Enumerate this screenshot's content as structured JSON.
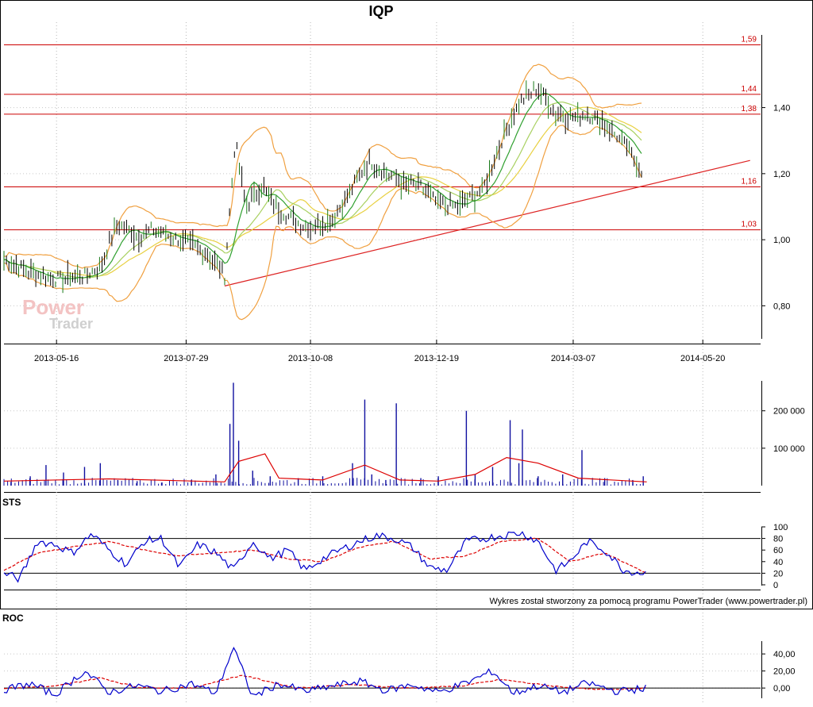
{
  "chart_data": [
    {
      "type": "candlestick",
      "title": "IQP",
      "x_tick_labels": [
        "2013-05-16",
        "2013-07-29",
        "2013-10-08",
        "2013-12-19",
        "2014-03-07",
        "2014-05-20"
      ],
      "x_range": [
        "2013-04-16",
        "2014-06-22"
      ],
      "y_tick_labels": [
        "1,40",
        "1,20",
        "1,00",
        "0,80"
      ],
      "ylim": [
        0.7,
        1.62
      ],
      "grid": true,
      "horizontal_levels": [
        {
          "value": 1.59,
          "label": "1,59"
        },
        {
          "value": 1.44,
          "label": "1,44"
        },
        {
          "value": 1.38,
          "label": "1,38"
        },
        {
          "value": 1.16,
          "label": "1,16"
        },
        {
          "value": 1.03,
          "label": "1,03"
        }
      ],
      "trend_line": {
        "start": {
          "date": "2013-08-20",
          "value": 0.86
        },
        "end": {
          "date": "2014-06-16",
          "value": 1.24
        }
      },
      "close_series": {
        "dates": [
          "2013-04-16",
          "2013-05-01",
          "2013-05-16",
          "2013-06-01",
          "2013-06-10",
          "2013-06-20",
          "2013-07-01",
          "2013-07-10",
          "2013-07-20",
          "2013-07-29",
          "2013-08-10",
          "2013-08-20",
          "2013-08-26",
          "2013-09-01",
          "2013-09-10",
          "2013-09-20",
          "2013-10-01",
          "2013-10-08",
          "2013-10-20",
          "2013-10-30",
          "2013-11-10",
          "2013-11-20",
          "2013-12-01",
          "2013-12-10",
          "2013-12-19",
          "2014-01-01",
          "2014-01-15",
          "2014-01-25",
          "2014-02-05",
          "2014-02-15",
          "2014-02-25",
          "2014-03-07",
          "2014-03-15",
          "2014-03-25",
          "2014-04-05",
          "2014-04-15"
        ],
        "values": [
          0.94,
          0.9,
          0.88,
          0.89,
          0.92,
          1.05,
          1.01,
          1.03,
          1.01,
          0.99,
          0.96,
          0.89,
          1.3,
          1.1,
          1.16,
          1.09,
          1.05,
          1.04,
          1.06,
          1.14,
          1.24,
          1.2,
          1.17,
          1.16,
          1.11,
          1.1,
          1.16,
          1.3,
          1.42,
          1.46,
          1.38,
          1.37,
          1.38,
          1.35,
          1.29,
          1.21
        ]
      }
    },
    {
      "type": "bar",
      "title": "",
      "y_tick_labels": [
        "200 000",
        "100 000"
      ],
      "ylim": [
        0,
        280000
      ],
      "bars": {
        "dates": [
          "2013-04-20",
          "2013-05-01",
          "2013-05-10",
          "2013-05-20",
          "2013-06-01",
          "2013-06-10",
          "2013-06-20",
          "2013-07-01",
          "2013-07-15",
          "2013-08-01",
          "2013-08-15",
          "2013-08-23",
          "2013-08-25",
          "2013-08-28",
          "2013-09-05",
          "2013-09-15",
          "2013-10-01",
          "2013-10-15",
          "2013-11-01",
          "2013-11-08",
          "2013-11-12",
          "2013-11-20",
          "2013-11-26",
          "2013-12-10",
          "2013-12-20",
          "2014-01-05",
          "2014-01-10",
          "2014-01-20",
          "2014-01-30",
          "2014-02-04",
          "2014-02-06",
          "2014-02-15",
          "2014-03-01",
          "2014-03-12",
          "2014-03-25",
          "2014-04-10",
          "2014-04-16"
        ],
        "values": [
          10000,
          25000,
          55000,
          35000,
          50000,
          60000,
          15000,
          12000,
          8000,
          15000,
          30000,
          165000,
          275000,
          120000,
          40000,
          25000,
          20000,
          25000,
          60000,
          230000,
          30000,
          15000,
          220000,
          20000,
          25000,
          200000,
          30000,
          50000,
          175000,
          60000,
          150000,
          25000,
          30000,
          95000,
          20000,
          15000,
          25000
        ]
      },
      "average_line": {
        "dates": [
          "2013-04-16",
          "2013-06-15",
          "2013-08-20",
          "2013-08-28",
          "2013-09-12",
          "2013-09-20",
          "2013-10-15",
          "2013-11-08",
          "2013-11-28",
          "2013-12-20",
          "2014-01-10",
          "2014-01-28",
          "2014-02-15",
          "2014-03-10",
          "2014-04-18"
        ],
        "values": [
          12000,
          18000,
          10000,
          65000,
          85000,
          20000,
          15000,
          55000,
          15000,
          12000,
          30000,
          75000,
          60000,
          20000,
          10000
        ]
      }
    },
    {
      "type": "line",
      "title": "STS",
      "y_tick_labels": [
        "100",
        "80",
        "60",
        "40",
        "20",
        "0"
      ],
      "ylim": [
        0,
        100
      ],
      "reference_levels": [
        80,
        20
      ],
      "series": [
        {
          "color": "#0000cc",
          "dates": [
            "2013-04-16",
            "2013-04-25",
            "2013-05-05",
            "2013-05-15",
            "2013-05-25",
            "2013-06-05",
            "2013-06-15",
            "2013-06-25",
            "2013-07-05",
            "2013-07-15",
            "2013-07-25",
            "2013-08-05",
            "2013-08-15",
            "2013-08-25",
            "2013-09-05",
            "2013-09-15",
            "2013-09-25",
            "2013-10-05",
            "2013-10-15",
            "2013-10-25",
            "2013-11-05",
            "2013-11-15",
            "2013-11-25",
            "2013-12-05",
            "2013-12-15",
            "2013-12-25",
            "2014-01-05",
            "2014-01-15",
            "2014-01-25",
            "2014-02-05",
            "2014-02-15",
            "2014-02-25",
            "2014-03-05",
            "2014-03-15",
            "2014-03-25",
            "2014-04-05",
            "2014-04-18"
          ],
          "values": [
            20,
            10,
            75,
            70,
            55,
            88,
            60,
            35,
            75,
            80,
            30,
            70,
            55,
            25,
            75,
            45,
            60,
            25,
            45,
            60,
            75,
            85,
            80,
            65,
            30,
            25,
            75,
            80,
            85,
            90,
            75,
            25,
            40,
            75,
            60,
            25,
            20
          ]
        },
        {
          "color": "#dd0000",
          "dates": [
            "2013-04-16",
            "2013-05-05",
            "2013-05-25",
            "2013-06-15",
            "2013-07-05",
            "2013-07-25",
            "2013-08-15",
            "2013-09-05",
            "2013-09-25",
            "2013-10-15",
            "2013-11-05",
            "2013-11-25",
            "2013-12-15",
            "2014-01-05",
            "2014-01-25",
            "2014-02-15",
            "2014-03-05",
            "2014-03-25",
            "2014-04-18"
          ],
          "values": [
            25,
            55,
            65,
            75,
            60,
            50,
            55,
            60,
            45,
            40,
            65,
            75,
            45,
            50,
            75,
            80,
            40,
            55,
            20
          ]
        }
      ]
    },
    {
      "type": "line",
      "title": "ROC",
      "y_tick_labels": [
        "40,00",
        "20,00",
        "0,00"
      ],
      "ylim": [
        -12,
        55
      ],
      "reference_levels": [
        0
      ],
      "series": [
        {
          "color": "#0000cc",
          "dates": [
            "2013-04-16",
            "2013-05-01",
            "2013-05-15",
            "2013-06-01",
            "2013-06-15",
            "2013-07-01",
            "2013-07-15",
            "2013-08-01",
            "2013-08-15",
            "2013-08-25",
            "2013-09-05",
            "2013-09-20",
            "2013-10-05",
            "2013-10-20",
            "2013-11-05",
            "2013-11-20",
            "2013-12-05",
            "2013-12-20",
            "2014-01-05",
            "2014-01-20",
            "2014-02-01",
            "2014-02-15",
            "2014-03-01",
            "2014-03-15",
            "2014-04-01",
            "2014-04-18"
          ],
          "values": [
            -2,
            5,
            -8,
            20,
            -5,
            3,
            -4,
            5,
            -6,
            48,
            -10,
            5,
            -4,
            2,
            8,
            -3,
            4,
            -5,
            6,
            20,
            -6,
            3,
            -5,
            6,
            -4,
            0
          ]
        },
        {
          "color": "#dd0000",
          "dates": [
            "2013-04-16",
            "2013-05-15",
            "2013-06-10",
            "2013-07-01",
            "2013-08-01",
            "2013-08-30",
            "2013-09-30",
            "2013-11-01",
            "2013-12-01",
            "2014-01-01",
            "2014-01-25",
            "2014-02-20",
            "2014-03-20",
            "2014-04-18"
          ],
          "values": [
            0,
            2,
            12,
            1,
            0,
            15,
            0,
            4,
            0,
            2,
            10,
            3,
            -2,
            0
          ]
        }
      ]
    }
  ],
  "footer": {
    "credit": "Wykres został stworzony za pomocą programu PowerTrader (www.powertrader.pl)"
  },
  "watermark": {
    "line1": "Power",
    "line2": "Trader"
  }
}
